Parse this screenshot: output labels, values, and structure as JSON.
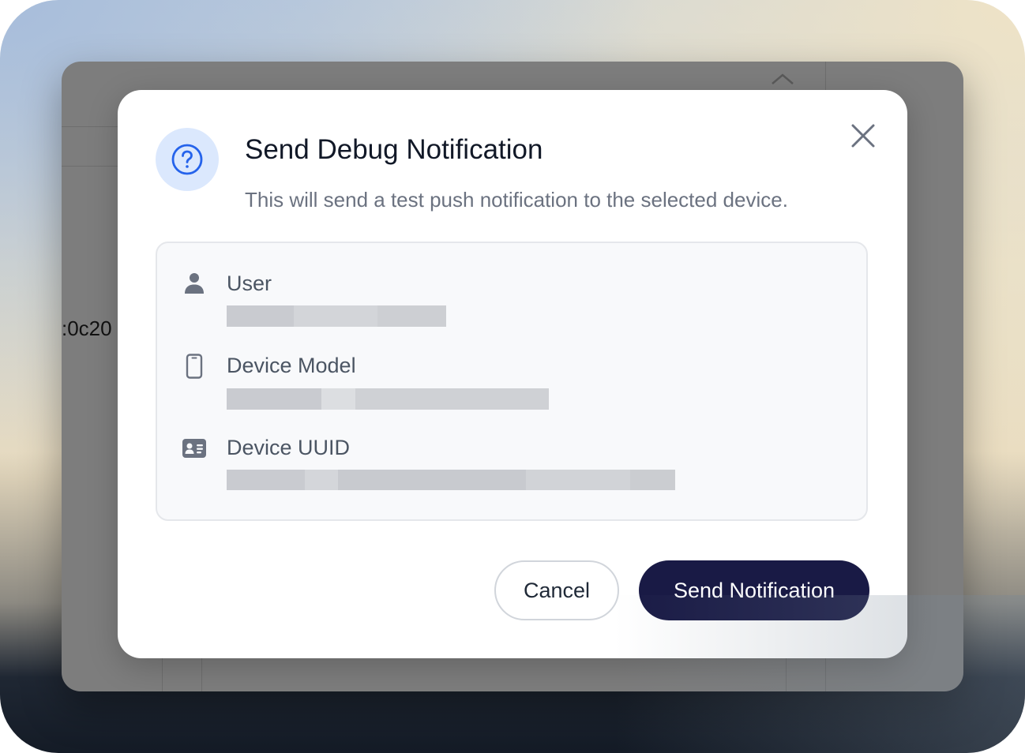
{
  "background_window": {
    "partial_id_text": ":0c20"
  },
  "dialog": {
    "title": "Send Debug Notification",
    "subtitle": "This will send a test push notification to the selected device.",
    "icon": "question-circle-icon",
    "close_icon": "close-icon",
    "fields": [
      {
        "label": "User",
        "icon": "user-icon",
        "value_redacted": true
      },
      {
        "label": "Device Model",
        "icon": "smartphone-icon",
        "value_redacted": true
      },
      {
        "label": "Device UUID",
        "icon": "id-card-icon",
        "value_redacted": true
      }
    ],
    "buttons": {
      "cancel_label": "Cancel",
      "send_label": "Send Notification"
    }
  },
  "colors": {
    "accent_blue": "#2563eb",
    "icon_circle_bg": "#dbe8fd",
    "primary_button": "#191a45",
    "overlay": "#7d7d7d"
  }
}
